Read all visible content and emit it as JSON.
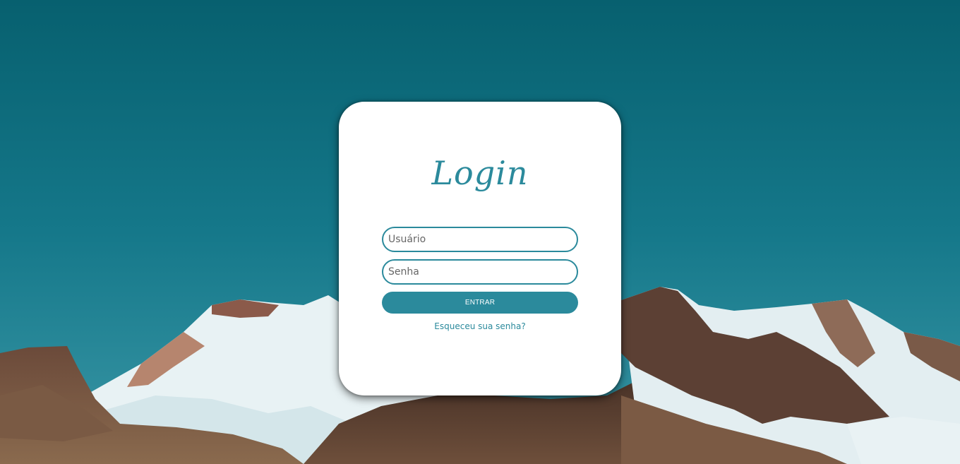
{
  "login": {
    "title": "Login",
    "username_placeholder": "Usuário",
    "password_placeholder": "Senha",
    "submit_label": "ENTRAR",
    "forgot_password_link": "Esqueceu sua senha?"
  },
  "colors": {
    "accent": "#2b8a9c",
    "card_background": "#ffffff",
    "sky": "#0f6f80"
  },
  "background": {
    "icon": "mountain-landscape-image"
  }
}
